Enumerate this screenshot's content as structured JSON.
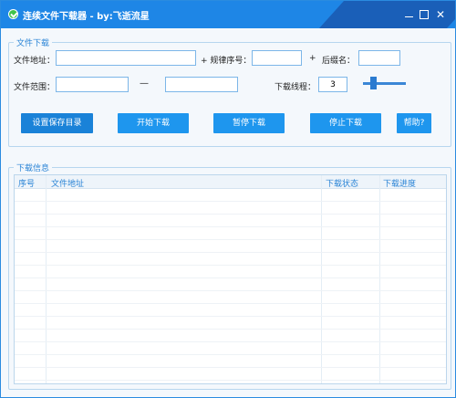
{
  "window": {
    "title": "连续文件下载器 - by:飞逝流星"
  },
  "download_group": {
    "legend": "文件下载",
    "file_address_label": "文件地址：",
    "rule_seq_label": "+ 规律序号：",
    "plus_sign": "+",
    "suffix_label": "后缀名：",
    "file_range_label": "文件范围：",
    "range_dash": "—",
    "threads_label": "下载线程：",
    "threads_value": "3",
    "file_address_value": "",
    "rule_seq_value": "",
    "suffix_value": "",
    "range_start_value": "",
    "range_end_value": ""
  },
  "buttons": {
    "set_save_dir": "设置保存目录",
    "start_download": "开始下载",
    "pause_download": "暂停下载",
    "stop_download": "停止下载",
    "help": "帮助?"
  },
  "info_group": {
    "legend": "下载信息",
    "columns": [
      "序号",
      "文件地址",
      "下载状态",
      "下载进度"
    ],
    "rows": []
  },
  "colors": {
    "titlebar": "#1e86e6",
    "accent": "#1e96ee",
    "legend_text": "#2a84d6"
  }
}
